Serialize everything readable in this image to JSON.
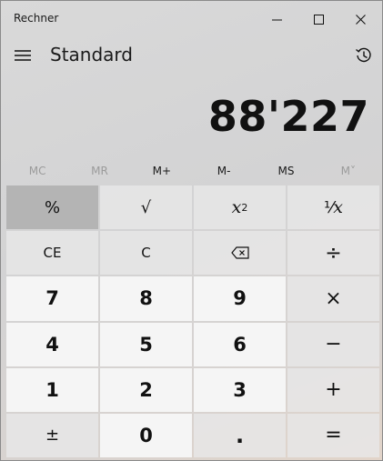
{
  "window": {
    "title": "Rechner"
  },
  "header": {
    "mode": "Standard"
  },
  "display": {
    "value": "88'227"
  },
  "memory": [
    {
      "label": "MC",
      "enabled": false
    },
    {
      "label": "MR",
      "enabled": false
    },
    {
      "label": "M+",
      "enabled": true
    },
    {
      "label": "M-",
      "enabled": true
    },
    {
      "label": "MS",
      "enabled": true
    },
    {
      "label": "M˅",
      "enabled": false
    }
  ],
  "keys": {
    "percent": "%",
    "sqrt": "√",
    "square_base": "x",
    "square_exp": "2",
    "reciprocal_num": "⅟",
    "reciprocal_x": "x",
    "ce": "CE",
    "clear": "C",
    "divide": "÷",
    "seven": "7",
    "eight": "8",
    "nine": "9",
    "multiply": "×",
    "four": "4",
    "five": "5",
    "six": "6",
    "minus": "−",
    "one": "1",
    "two": "2",
    "three": "3",
    "plus": "+",
    "negate": "±",
    "zero": "0",
    "decimal": ".",
    "equals": "="
  },
  "icons": {
    "minimize": "minimize-icon",
    "maximize": "maximize-icon",
    "close": "close-icon",
    "menu": "hamburger-menu-icon",
    "history": "history-icon",
    "backspace": "backspace-icon"
  }
}
